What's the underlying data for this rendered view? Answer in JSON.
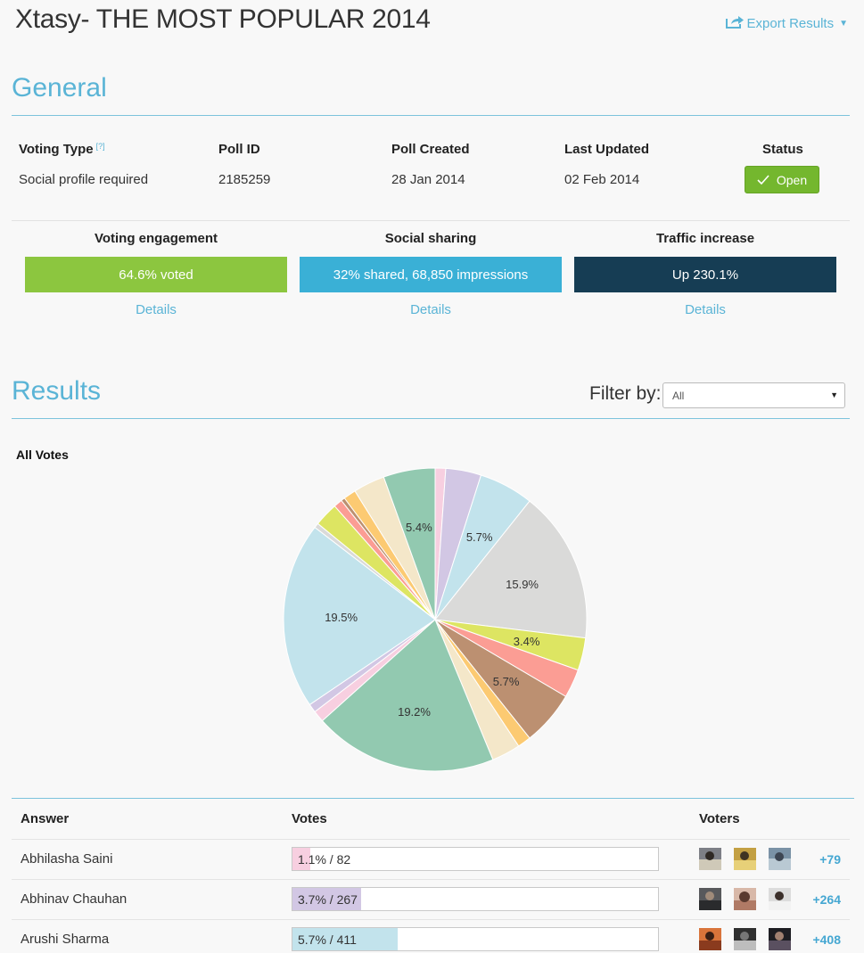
{
  "header": {
    "title": "Xtasy- THE MOST POPULAR 2014",
    "export_label": "Export Results"
  },
  "general": {
    "title": "General",
    "meta": {
      "voting_type_label": "Voting Type",
      "voting_type_help": "[?]",
      "voting_type_value": "Social profile required",
      "poll_id_label": "Poll ID",
      "poll_id_value": "2185259",
      "created_label": "Poll Created",
      "created_value": "28 Jan 2014",
      "updated_label": "Last Updated",
      "updated_value": "02 Feb 2014",
      "status_label": "Status",
      "status_value": "Open"
    },
    "metrics": [
      {
        "title": "Voting engagement",
        "value": "64.6% voted",
        "link": "Details",
        "color": "#8cc63f"
      },
      {
        "title": "Social sharing",
        "value": "32% shared, 68,850 impressions",
        "link": "Details",
        "color": "#3ab0d6"
      },
      {
        "title": "Traffic increase",
        "value": "Up 230.1%",
        "link": "Details",
        "color": "#163d54"
      }
    ]
  },
  "results": {
    "title": "Results",
    "filter_label": "Filter by:",
    "filter_value": "All",
    "chart_title": "All Votes",
    "table": {
      "headers": {
        "answer": "Answer",
        "votes": "Votes",
        "voters": "Voters"
      },
      "rows": [
        {
          "answer": "Abhilasha Saini",
          "votes": "1.1% / 82",
          "pct": 1.1,
          "color": "#f7cfe0",
          "more": "+79"
        },
        {
          "answer": "Abhinav Chauhan",
          "votes": "3.7% / 267",
          "pct": 3.7,
          "color": "#d2c7e4",
          "more": "+264"
        },
        {
          "answer": "Arushi Sharma",
          "votes": "5.7% / 411",
          "pct": 5.7,
          "color": "#c2e3ec",
          "more": "+408"
        }
      ]
    }
  },
  "chart_data": {
    "type": "pie",
    "title": "All Votes",
    "slices": [
      {
        "value": 1.1,
        "color": "#f7cfe0",
        "label": ""
      },
      {
        "value": 3.7,
        "color": "#d2c7e4",
        "label": ""
      },
      {
        "value": 5.7,
        "color": "#c2e3ec",
        "label": "5.7%"
      },
      {
        "value": 15.9,
        "color": "#dadad9",
        "label": "15.9%"
      },
      {
        "value": 3.4,
        "color": "#dde562",
        "label": "3.4%"
      },
      {
        "value": 3.0,
        "color": "#fb9d94",
        "label": ""
      },
      {
        "value": 5.7,
        "color": "#bc9071",
        "label": "5.7%"
      },
      {
        "value": 1.4,
        "color": "#fcca72",
        "label": ""
      },
      {
        "value": 3.0,
        "color": "#f4e7c9",
        "label": ""
      },
      {
        "value": 19.2,
        "color": "#92c9b0",
        "label": "19.2%"
      },
      {
        "value": 1.2,
        "color": "#f7cfe0",
        "label": ""
      },
      {
        "value": 0.9,
        "color": "#d2c7e4",
        "label": ""
      },
      {
        "value": 19.5,
        "color": "#c2e3ec",
        "label": "19.5%"
      },
      {
        "value": 0.5,
        "color": "#dadad9",
        "label": ""
      },
      {
        "value": 2.5,
        "color": "#dde562",
        "label": ""
      },
      {
        "value": 0.9,
        "color": "#fb9d94",
        "label": ""
      },
      {
        "value": 0.4,
        "color": "#bc9071",
        "label": ""
      },
      {
        "value": 1.3,
        "color": "#fcca72",
        "label": ""
      },
      {
        "value": 3.3,
        "color": "#f4e7c9",
        "label": ""
      },
      {
        "value": 5.4,
        "color": "#92c9b0",
        "label": "5.4%"
      }
    ]
  }
}
